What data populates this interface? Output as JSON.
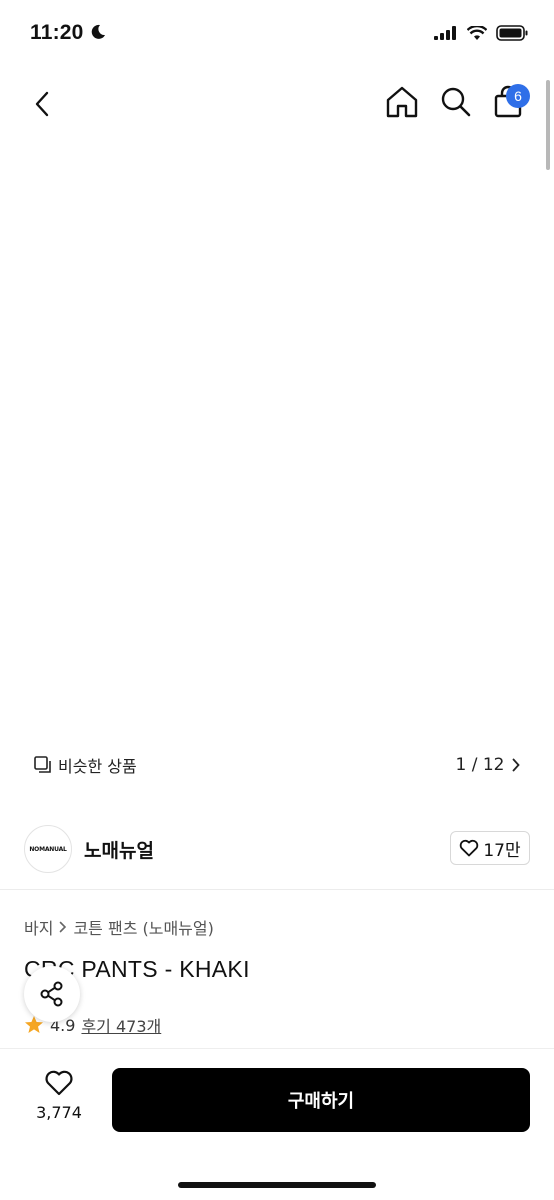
{
  "status_bar": {
    "time": "11:20"
  },
  "header": {
    "cart_count": "6"
  },
  "gallery": {
    "similar_label": "비슷한 상품",
    "pager_label": "1 / 12"
  },
  "brand": {
    "logo_text": "NOMANUAL",
    "name": "노매뉴얼",
    "likes": "17만"
  },
  "product": {
    "breadcrumb": [
      "바지",
      "코튼 팬츠 (노매뉴얼)"
    ],
    "title": "CRC PANTS - KHAKI",
    "rating": "4.9",
    "reviews": "후기 473개"
  },
  "bottom": {
    "wish_count": "3,774",
    "buy_label": "구매하기"
  },
  "colors": {
    "accent": "#2f6fe8",
    "buy_button": "#000000",
    "star": "#f5a623",
    "pants_body": "#5b6258",
    "pants_side": "#2a2e2c"
  }
}
